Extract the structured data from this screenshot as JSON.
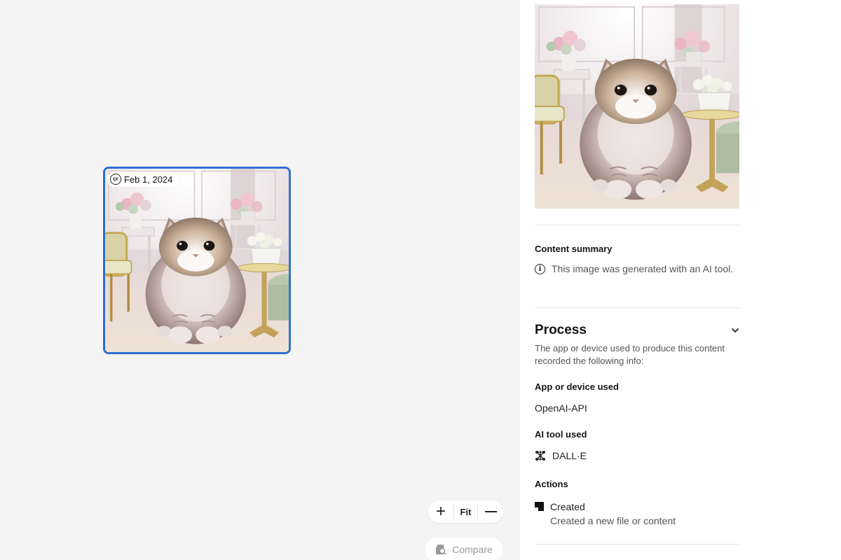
{
  "canvas": {
    "thumbnail": {
      "badge_icon": "content-credentials-cr-icon",
      "badge_icon_text": "cr",
      "date": "Feb 1, 2024",
      "image_alt": "Fluffy cat sitting in a pastel living room",
      "selected_border_color": "#2d6fd3"
    },
    "zoom_controls": {
      "zoom_in_icon": "plus-icon",
      "fit_label": "Fit",
      "zoom_out_icon": "minus-icon"
    },
    "compare": {
      "icon": "compare-search-icon",
      "label": "Compare"
    }
  },
  "panel": {
    "preview_alt": "Fluffy cat sitting in a pastel living room",
    "content_summary": {
      "heading": "Content summary",
      "icon": "info-icon",
      "icon_text": "i",
      "text": "This image was generated with an AI tool."
    },
    "process": {
      "title": "Process",
      "toggle_icon": "chevron-down-icon",
      "description": "The app or device used to produce this content recorded the following info:",
      "app_heading": "App or device used",
      "app_value": "OpenAI-API",
      "ai_tool_heading": "AI tool used",
      "ai_tool_icon": "dalle-network-icon",
      "ai_tool_value": "DALL·E",
      "actions_heading": "Actions",
      "actions": [
        {
          "icon": "created-document-icon",
          "title": "Created",
          "subtitle": "Created a new file or content"
        }
      ]
    }
  },
  "colors": {
    "canvas_bg": "#f4f4f4",
    "panel_bg": "#ffffff",
    "accent": "#2d6fd3"
  }
}
